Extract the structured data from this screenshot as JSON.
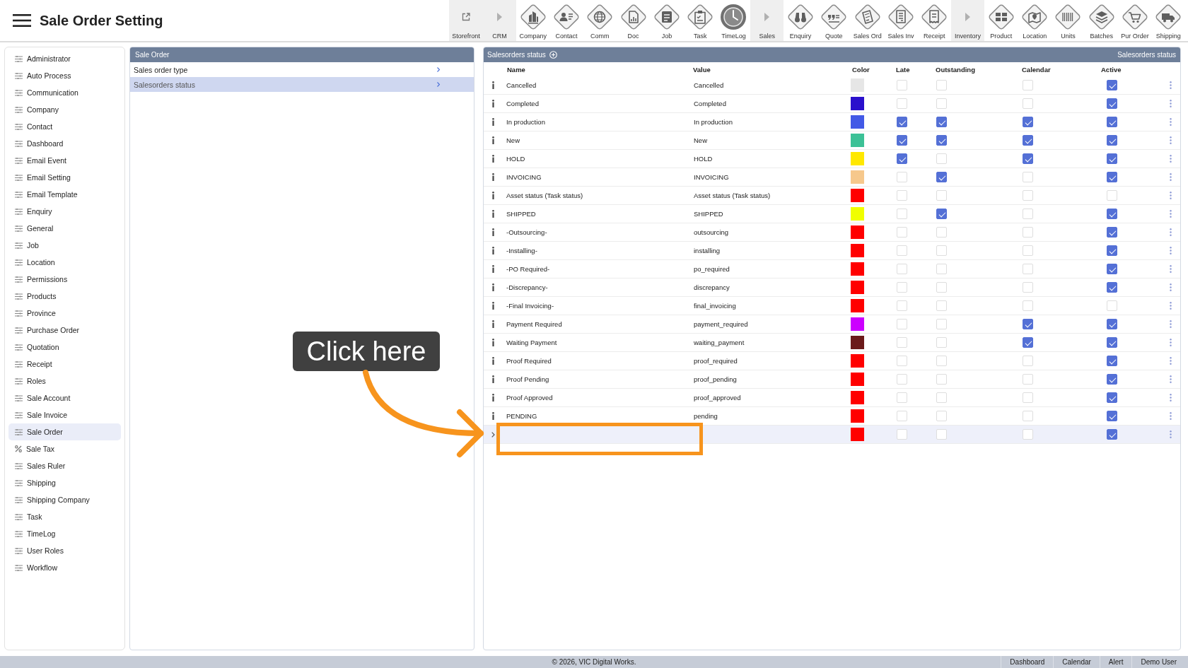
{
  "header": {
    "title": "Sale Order Setting"
  },
  "toolbar": [
    {
      "label": "Storefront",
      "kind": "external"
    },
    {
      "label": "CRM",
      "kind": "section"
    },
    {
      "label": "Company",
      "kind": "module"
    },
    {
      "label": "Contact",
      "kind": "module"
    },
    {
      "label": "Comm",
      "kind": "module"
    },
    {
      "label": "Doc",
      "kind": "module"
    },
    {
      "label": "Job",
      "kind": "module"
    },
    {
      "label": "Task",
      "kind": "module"
    },
    {
      "label": "TimeLog",
      "kind": "module"
    },
    {
      "label": "Sales",
      "kind": "section"
    },
    {
      "label": "Enquiry",
      "kind": "module"
    },
    {
      "label": "Quote",
      "kind": "module"
    },
    {
      "label": "Sales Ord",
      "kind": "module"
    },
    {
      "label": "Sales Inv",
      "kind": "module"
    },
    {
      "label": "Receipt",
      "kind": "module"
    },
    {
      "label": "Inventory",
      "kind": "section"
    },
    {
      "label": "Product",
      "kind": "module"
    },
    {
      "label": "Location",
      "kind": "module"
    },
    {
      "label": "Units",
      "kind": "module"
    },
    {
      "label": "Batches",
      "kind": "module"
    },
    {
      "label": "Pur Order",
      "kind": "module"
    },
    {
      "label": "Shipping",
      "kind": "module"
    }
  ],
  "sidebar": {
    "items": [
      {
        "label": "Administrator",
        "kind": "settings",
        "selected": false
      },
      {
        "label": "Auto Process",
        "kind": "settings",
        "selected": false
      },
      {
        "label": "Communication",
        "kind": "settings",
        "selected": false
      },
      {
        "label": "Company",
        "kind": "settings",
        "selected": false
      },
      {
        "label": "Contact",
        "kind": "settings",
        "selected": false
      },
      {
        "label": "Dashboard",
        "kind": "settings",
        "selected": false
      },
      {
        "label": "Email Event",
        "kind": "settings",
        "selected": false
      },
      {
        "label": "Email Setting",
        "kind": "settings",
        "selected": false
      },
      {
        "label": "Email Template",
        "kind": "settings",
        "selected": false
      },
      {
        "label": "Enquiry",
        "kind": "settings",
        "selected": false
      },
      {
        "label": "General",
        "kind": "settings",
        "selected": false
      },
      {
        "label": "Job",
        "kind": "settings",
        "selected": false
      },
      {
        "label": "Location",
        "kind": "settings",
        "selected": false
      },
      {
        "label": "Permissions",
        "kind": "settings",
        "selected": false
      },
      {
        "label": "Products",
        "kind": "settings",
        "selected": false
      },
      {
        "label": "Province",
        "kind": "settings",
        "selected": false
      },
      {
        "label": "Purchase Order",
        "kind": "settings",
        "selected": false
      },
      {
        "label": "Quotation",
        "kind": "settings",
        "selected": false
      },
      {
        "label": "Receipt",
        "kind": "settings",
        "selected": false
      },
      {
        "label": "Roles",
        "kind": "settings",
        "selected": false
      },
      {
        "label": "Sale Account",
        "kind": "settings",
        "selected": false
      },
      {
        "label": "Sale Invoice",
        "kind": "settings",
        "selected": false
      },
      {
        "label": "Sale Order",
        "kind": "settings",
        "selected": true
      },
      {
        "label": "Sale Tax",
        "kind": "tax",
        "selected": false
      },
      {
        "label": "Sales Ruler",
        "kind": "settings",
        "selected": false
      },
      {
        "label": "Shipping",
        "kind": "settings",
        "selected": false
      },
      {
        "label": "Shipping Company",
        "kind": "settings",
        "selected": false
      },
      {
        "label": "Task",
        "kind": "settings",
        "selected": false
      },
      {
        "label": "TimeLog",
        "kind": "settings",
        "selected": false
      },
      {
        "label": "User Roles",
        "kind": "settings",
        "selected": false
      },
      {
        "label": "Workflow",
        "kind": "settings",
        "selected": false
      }
    ]
  },
  "menu_panel": {
    "title": "Sale Order",
    "items": [
      {
        "label": "Sales order type",
        "selected": false
      },
      {
        "label": "Salesorders status",
        "selected": true
      }
    ]
  },
  "status_panel": {
    "title": "Salesorders status",
    "caption": "Salesorders status",
    "columns": [
      "Name",
      "Value",
      "Color",
      "Late",
      "Outstanding",
      "Calendar",
      "Active"
    ],
    "rows": [
      {
        "kind": "status",
        "name": "Cancelled",
        "value": "Cancelled",
        "color": "#e6e6e6",
        "late": false,
        "outstanding": false,
        "calendar": false,
        "active": true,
        "selected": false
      },
      {
        "kind": "status",
        "name": "Completed",
        "value": "Completed",
        "color": "#2a10cc",
        "late": false,
        "outstanding": false,
        "calendar": false,
        "active": true,
        "selected": false
      },
      {
        "kind": "status",
        "name": "In production",
        "value": "In production",
        "color": "#4259e6",
        "late": true,
        "outstanding": true,
        "calendar": true,
        "active": true,
        "selected": false
      },
      {
        "kind": "status",
        "name": "New",
        "value": "New",
        "color": "#3cc196",
        "late": true,
        "outstanding": true,
        "calendar": true,
        "active": true,
        "selected": false
      },
      {
        "kind": "status",
        "name": "HOLD",
        "value": "HOLD",
        "color": "#ffe800",
        "late": true,
        "outstanding": false,
        "calendar": true,
        "active": true,
        "selected": false
      },
      {
        "kind": "status",
        "name": "INVOICING",
        "value": "INVOICING",
        "color": "#f6c88c",
        "late": false,
        "outstanding": true,
        "calendar": false,
        "active": true,
        "selected": false
      },
      {
        "kind": "status",
        "name": "Asset status (Task status)",
        "value": "Asset status (Task status)",
        "color": "#ff0000",
        "late": false,
        "outstanding": false,
        "calendar": false,
        "active": false,
        "selected": false
      },
      {
        "kind": "status",
        "name": "SHIPPED",
        "value": "SHIPPED",
        "color": "#f0ff00",
        "late": false,
        "outstanding": true,
        "calendar": false,
        "active": true,
        "selected": false
      },
      {
        "kind": "status",
        "name": "-Outsourcing-",
        "value": "outsourcing",
        "color": "#ff0000",
        "late": false,
        "outstanding": false,
        "calendar": false,
        "active": true,
        "selected": false
      },
      {
        "kind": "status",
        "name": "-Installing-",
        "value": "installing",
        "color": "#ff0000",
        "late": false,
        "outstanding": false,
        "calendar": false,
        "active": true,
        "selected": false
      },
      {
        "kind": "status",
        "name": "-PO Required-",
        "value": "po_required",
        "color": "#ff0000",
        "late": false,
        "outstanding": false,
        "calendar": false,
        "active": true,
        "selected": false
      },
      {
        "kind": "status",
        "name": "-Discrepancy-",
        "value": "discrepancy",
        "color": "#ff0000",
        "late": false,
        "outstanding": false,
        "calendar": false,
        "active": true,
        "selected": false
      },
      {
        "kind": "status",
        "name": "-Final Invoicing-",
        "value": "final_invoicing",
        "color": "#ff0000",
        "late": false,
        "outstanding": false,
        "calendar": false,
        "active": false,
        "selected": false
      },
      {
        "kind": "status",
        "name": "Payment Required",
        "value": "payment_required",
        "color": "#cc00ff",
        "late": false,
        "outstanding": false,
        "calendar": true,
        "active": true,
        "selected": false
      },
      {
        "kind": "status",
        "name": "Waiting Payment",
        "value": "waiting_payment",
        "color": "#6b1a1a",
        "late": false,
        "outstanding": false,
        "calendar": true,
        "active": true,
        "selected": false
      },
      {
        "kind": "status",
        "name": "Proof Required",
        "value": "proof_required",
        "color": "#ff0000",
        "late": false,
        "outstanding": false,
        "calendar": false,
        "active": true,
        "selected": false
      },
      {
        "kind": "status",
        "name": "Proof Pending",
        "value": "proof_pending",
        "color": "#ff0000",
        "late": false,
        "outstanding": false,
        "calendar": false,
        "active": true,
        "selected": false
      },
      {
        "kind": "status",
        "name": "Proof Approved",
        "value": "proof_approved",
        "color": "#ff0000",
        "late": false,
        "outstanding": false,
        "calendar": false,
        "active": true,
        "selected": false
      },
      {
        "kind": "status",
        "name": "PENDING",
        "value": "pending",
        "color": "#ff0000",
        "late": false,
        "outstanding": false,
        "calendar": false,
        "active": true,
        "selected": false
      },
      {
        "kind": "new",
        "color": "#ff0000",
        "late": false,
        "outstanding": false,
        "calendar": false,
        "active": true,
        "selected": true
      }
    ]
  },
  "footer": {
    "copyright": "© 2026, VIC Digital Works.",
    "links": [
      "Dashboard",
      "Calendar",
      "Alert",
      "Demo User"
    ]
  },
  "annotation": {
    "callout": "Click here"
  }
}
